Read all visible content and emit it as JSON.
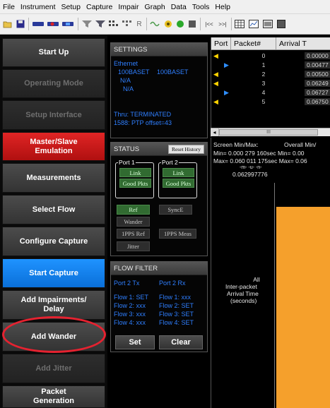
{
  "menu": [
    "File",
    "Instrument",
    "Setup",
    "Capture",
    "Impair",
    "Graph",
    "Data",
    "Tools",
    "Help"
  ],
  "toolbar": {
    "r_label": "R",
    "rewind_label": "|<<",
    "forward_label": ">>|"
  },
  "nav": {
    "start_up": "Start Up",
    "operating_mode": "Operating Mode",
    "setup_interface": "Setup Interface",
    "master_slave": "Master/Slave\nEmulation",
    "measurements": "Measurements",
    "select_flow": "Select Flow",
    "configure_capture": "Configure Capture",
    "start_capture": "Start Capture",
    "add_impairments": "Add Impairments/\nDelay",
    "add_wander": "Add Wander",
    "add_jitter": "Add Jitter",
    "packet_generation": "Packet\nGeneration"
  },
  "colors": {
    "accent_red": "#d61a1a",
    "accent_blue": "#128cff",
    "highlight_ring": "#e52230",
    "graph_fill": "#f5a02c",
    "info_text": "#2f7fff"
  },
  "settings": {
    "header": "SETTINGS",
    "line1": "Ethernet",
    "line2a": "100BASET",
    "line2b": "100BASET",
    "line3": "N/A",
    "line4": "N/A",
    "line5": "Thru: TERMINATED",
    "line6": "1588: PTP offset=43"
  },
  "status": {
    "header": "STATUS",
    "reset_label": "Reset History",
    "port1_label": "Port 1",
    "port2_label": "Port 2",
    "link": "Link",
    "good_pkts": "Good Pkts",
    "ref": "Ref",
    "synce": "SyncE",
    "wander": "Wander",
    "pps_ref": "1PPS Ref",
    "pps_meas": "1PPS Meas",
    "jitter": "Jitter"
  },
  "flow_filter": {
    "header": "FLOW FILTER",
    "col1_header": "Port 2 Tx",
    "col2_header": "Port 2 Rx",
    "col1": [
      "Flow 1: SET",
      "Flow 2: xxx",
      "Flow 3: xxx",
      "Flow 4: xxx"
    ],
    "col2": [
      "Flow 1: xxx",
      "Flow 2: SET",
      "Flow 3: SET",
      "Flow 4: SET"
    ],
    "set_label": "Set",
    "clear_label": "Clear"
  },
  "table": {
    "headers": [
      "Port",
      "Packet#",
      "Arrival T"
    ],
    "rows": [
      {
        "dir": "left",
        "packet": "0",
        "arrival": "0.00000"
      },
      {
        "dir": "right",
        "packet": "1",
        "arrival": "0.00477"
      },
      {
        "dir": "left",
        "packet": "2",
        "arrival": "0.00500"
      },
      {
        "dir": "left",
        "packet": "3",
        "arrival": "0.06249"
      },
      {
        "dir": "right",
        "packet": "4",
        "arrival": "0.06727"
      },
      {
        "dir": "left",
        "packet": "5",
        "arrival": "0.06750"
      }
    ],
    "scroll_grip": "III"
  },
  "graph": {
    "screen_minmax": "Screen Min/Max:",
    "overall_minmax": "Overall Min/",
    "min_line": "Min=   0.000 279 160sec  Min=   0.00",
    "max_line": "Max=   0.060 011 175sec  Max=   0.06",
    "tick_row": "-m-  -u-  -n-",
    "y_top_value": "0.062997776",
    "y_label_1": "All",
    "y_label_2": "Inter-packet",
    "y_label_3": "Arrival Time",
    "y_label_4": "(seconds)"
  }
}
